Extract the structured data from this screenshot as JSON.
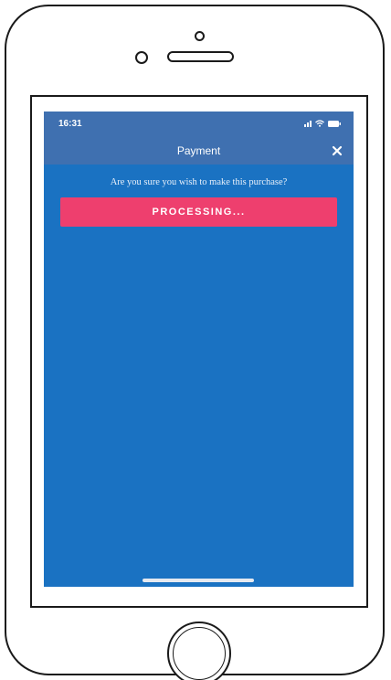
{
  "status_bar": {
    "time": "16:31"
  },
  "header": {
    "title": "Payment",
    "close_icon": "close-icon"
  },
  "main": {
    "confirm_text": "Are you sure you wish to make this purchase?",
    "processing_button_label": "PROCESSING..."
  },
  "colors": {
    "screen_background": "#1a72c2",
    "header_background": "#3f70b0",
    "button_background": "#ee3f6e",
    "text": "#ffffff"
  }
}
